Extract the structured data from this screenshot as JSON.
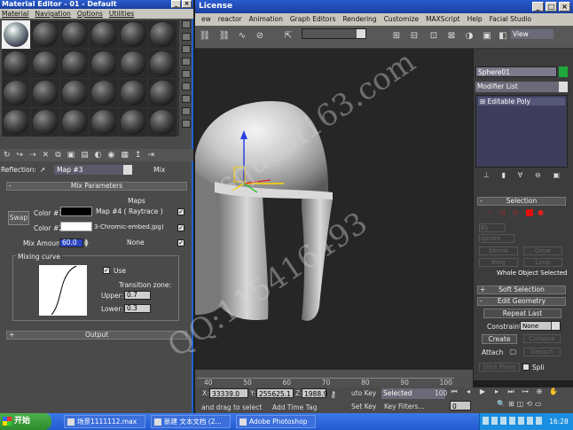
{
  "material_editor": {
    "title": "Material Editor - 01 - Default",
    "menu": [
      "Material",
      "Navigation",
      "Options",
      "Utilities"
    ],
    "reflection_label": "Reflection:",
    "map_name": "Map #3",
    "map_type": "Mix",
    "mix_params_title": "Mix Parameters",
    "swap_label": "Swap",
    "maps_header": "Maps",
    "color1_label": "Color #1",
    "color1_map": "Map #4  ( Raytrace )",
    "color2_label": "Color #2",
    "color2_map": "3-Chromic-embed.jpg)",
    "mix_amount_label": "Mix Amount:",
    "mix_amount_value": "60.0",
    "mix_map": "None",
    "mixing_curve_title": "Mixing curve",
    "use_curve_label": "Use",
    "transition_zone_label": "Transition zone:",
    "upper_label": "Upper:",
    "upper_value": "0.7",
    "lower_label": "Lower:",
    "lower_value": "0.3",
    "output_title": "Output",
    "colors": {
      "color1": "#000000",
      "color2": "#ffffff"
    }
  },
  "max": {
    "title": "License",
    "menu": [
      "ew",
      "reactor",
      "Animation",
      "Graph Editors",
      "Rendering",
      "Customize",
      "MAXScript",
      "Help",
      "Facial Studio"
    ],
    "view_dropdown": "View",
    "object_name": "Sphere01",
    "object_color": "#1fa83a",
    "modifier_list": "Modifier List",
    "stack_item": "Editable Poly",
    "selection_title": "Selection",
    "by_vertex_label": "By",
    "ignore_label": "Ignore",
    "shrink_label": "Shrink",
    "grow_label": "Grow",
    "ring_label": "Ring",
    "loop_label": "Loop",
    "whole_object_label": "Whole Object Selected",
    "soft_selection_title": "Soft Selection",
    "edit_geometry_title": "Edit Geometry",
    "repeat_last_label": "Repeat Last",
    "constraints_label": "Constraints:",
    "constraints_value": "None",
    "create_label": "Create",
    "collapse_label": "Collapse",
    "attach_label": "Attach",
    "detach_label": "Detach",
    "slice_plane_label": "Slice Plane",
    "split_label": "Spli",
    "timeline_ticks": [
      "40",
      "50",
      "60",
      "70",
      "80",
      "90",
      "100"
    ],
    "coord_x_label": "X:",
    "coord_x": "33339.0",
    "coord_y_label": "Y:",
    "coord_y": "255625.1",
    "coord_z_label": "Z:",
    "coord_z": "1988.9",
    "auto_key": "uto Key",
    "selected_dropdown": "Selected",
    "frame_value": "100",
    "status_text": "and drag to select",
    "add_time_tag": "Add Time Tag",
    "set_key": "Set Key",
    "key_filters": "Key Filters...",
    "frame_small": "0"
  },
  "watermark": {
    "line1": "squeal163.com",
    "line2": "QQ:115416493"
  },
  "taskbar": {
    "start": "开始",
    "tasks": [
      "场景1111112.max",
      "新建 文本文档 (2...",
      "Adobe Photoshop"
    ],
    "clock": "16:28"
  }
}
